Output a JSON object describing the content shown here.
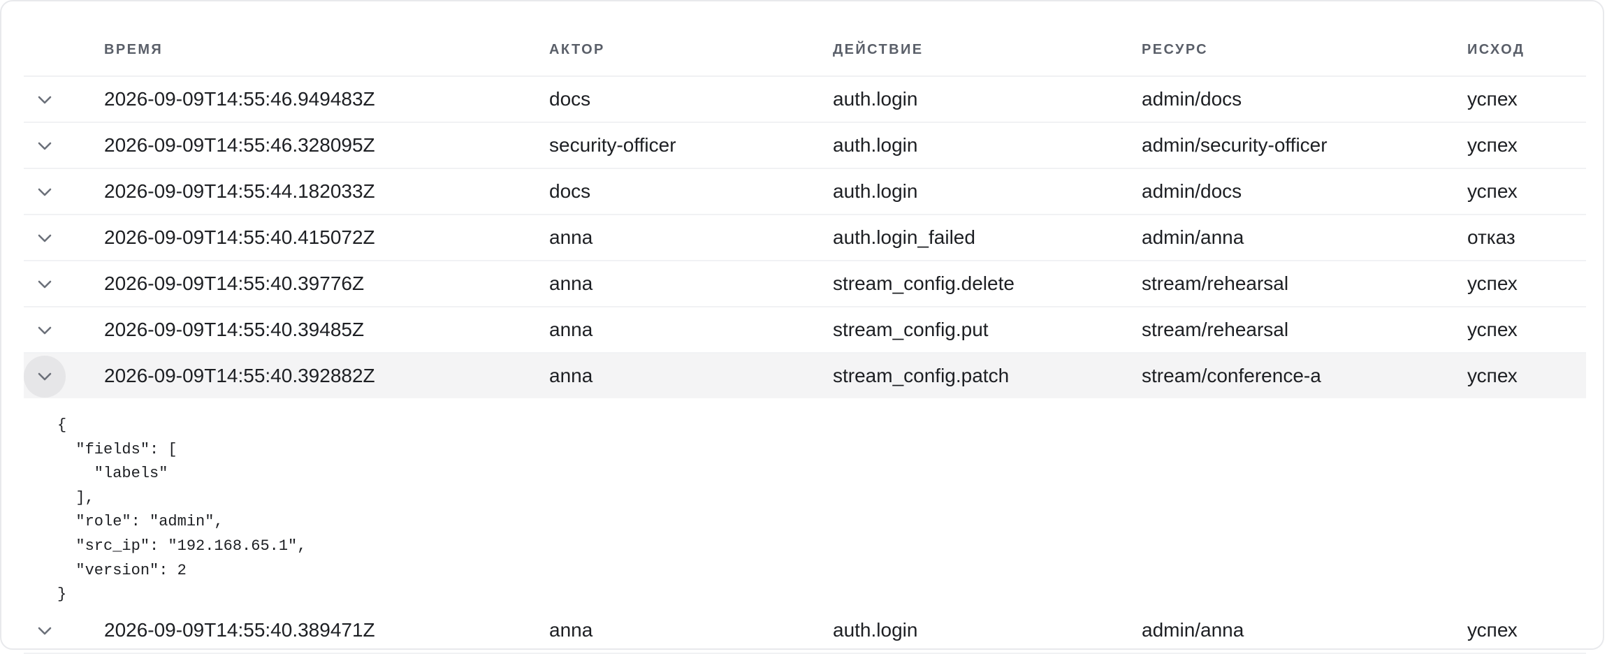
{
  "columns": {
    "time": "ВРЕМЯ",
    "actor": "АКТОР",
    "action": "ДЕЙСТВИЕ",
    "resource": "РЕСУРС",
    "outcome": "ИСХОД"
  },
  "rows": [
    {
      "time": "2026-09-09T14:55:46.949483Z",
      "actor": "docs",
      "action": "auth.login",
      "resource": "admin/docs",
      "outcome": "успех"
    },
    {
      "time": "2026-09-09T14:55:46.328095Z",
      "actor": "security-officer",
      "action": "auth.login",
      "resource": "admin/security-officer",
      "outcome": "успех"
    },
    {
      "time": "2026-09-09T14:55:44.182033Z",
      "actor": "docs",
      "action": "auth.login",
      "resource": "admin/docs",
      "outcome": "успех"
    },
    {
      "time": "2026-09-09T14:55:40.415072Z",
      "actor": "anna",
      "action": "auth.login_failed",
      "resource": "admin/anna",
      "outcome": "отказ"
    },
    {
      "time": "2026-09-09T14:55:40.39776Z",
      "actor": "anna",
      "action": "stream_config.delete",
      "resource": "stream/rehearsal",
      "outcome": "успех"
    },
    {
      "time": "2026-09-09T14:55:40.39485Z",
      "actor": "anna",
      "action": "stream_config.put",
      "resource": "stream/rehearsal",
      "outcome": "успех"
    },
    {
      "time": "2026-09-09T14:55:40.392882Z",
      "actor": "anna",
      "action": "stream_config.patch",
      "resource": "stream/conference-a",
      "outcome": "успех"
    },
    {
      "time": "2026-09-09T14:55:40.389471Z",
      "actor": "anna",
      "action": "auth.login",
      "resource": "admin/anna",
      "outcome": "успех"
    }
  ],
  "expanded_row": {
    "index": 6,
    "details_json": "{\n  \"fields\": [\n    \"labels\"\n  ],\n  \"role\": \"admin\",\n  \"src_ip\": \"192.168.65.1\",\n  \"version\": 2\n}"
  },
  "icons": {
    "toggle": "chevron-down-icon"
  },
  "colors": {
    "header_text": "#5a5f69",
    "expanded_row_bg": "#f4f4f5",
    "toggle_active_bg": "#e6e6e8",
    "chevron": "#6b7079"
  }
}
